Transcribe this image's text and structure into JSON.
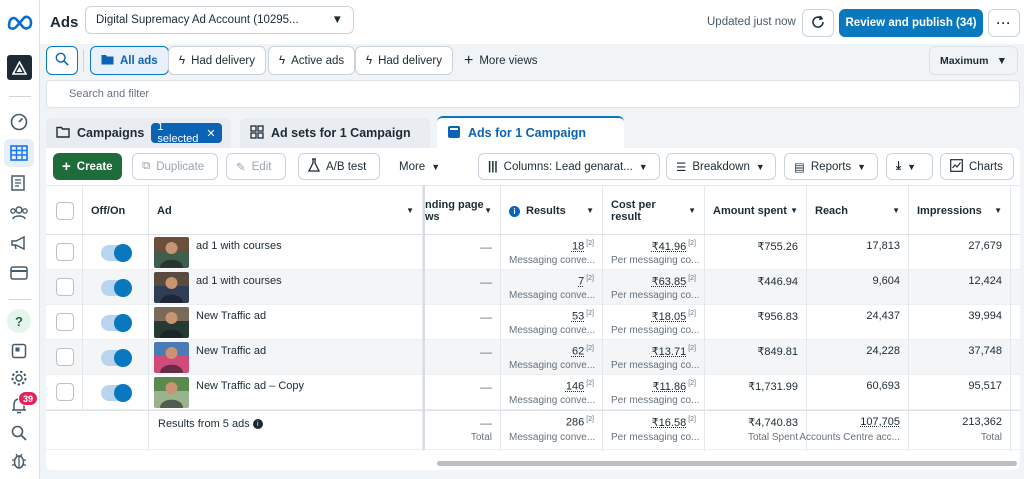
{
  "header": {
    "title": "Ads",
    "account": "Digital Supremacy Ad Account (10295...",
    "updated": "Updated just now",
    "publish_label": "Review and publish (34)"
  },
  "views": {
    "all_ads": "All ads",
    "had_delivery_1": "Had delivery",
    "active_ads": "Active ads",
    "had_delivery_2": "Had delivery",
    "more_views": "More views",
    "maximum": "Maximum"
  },
  "search": {
    "placeholder": "Search and filter"
  },
  "tabs": {
    "campaigns": "Campaigns",
    "selected_chip": "1 selected",
    "adsets": "Ad sets for 1 Campaign",
    "ads": "Ads for 1 Campaign"
  },
  "toolbar": {
    "create": "Create",
    "duplicate": "Duplicate",
    "edit": "Edit",
    "ab_test": "A/B test",
    "more": "More",
    "columns": "Columns: Lead genarat...",
    "breakdown": "Breakdown",
    "reports": "Reports",
    "charts": "Charts"
  },
  "columns": {
    "offon": "Off/On",
    "ad": "Ad",
    "landing_1": "nding page",
    "landing_2": "ws",
    "results": "Results",
    "cost_1": "Cost per",
    "cost_2": "result",
    "amount": "Amount spent",
    "reach": "Reach",
    "impressions": "Impressions"
  },
  "sup_mark": "[2]",
  "dash": "—",
  "rows": [
    {
      "name": "ad 1 with courses",
      "results": "18",
      "results_sub": "Messaging conve...",
      "cost": "₹41.96",
      "cost_sub": "Per messaging co...",
      "amount": "₹755.26",
      "reach": "17,813",
      "impressions": "27,679"
    },
    {
      "name": "ad 1 with courses",
      "results": "7",
      "results_sub": "Messaging conve...",
      "cost": "₹63.85",
      "cost_sub": "Per messaging co...",
      "amount": "₹446.94",
      "reach": "9,604",
      "impressions": "12,424"
    },
    {
      "name": "New Traffic ad",
      "results": "53",
      "results_sub": "Messaging conve...",
      "cost": "₹18.05",
      "cost_sub": "Per messaging co...",
      "amount": "₹956.83",
      "reach": "24,437",
      "impressions": "39,994"
    },
    {
      "name": "New Traffic ad",
      "results": "62",
      "results_sub": "Messaging conve...",
      "cost": "₹13.71",
      "cost_sub": "Per messaging co...",
      "amount": "₹849.81",
      "reach": "24,228",
      "impressions": "37,748"
    },
    {
      "name": "New Traffic ad – Copy",
      "results": "146",
      "results_sub": "Messaging conve...",
      "cost": "₹11.86",
      "cost_sub": "Per messaging co...",
      "amount": "₹1,731.99",
      "reach": "60,693",
      "impressions": "95,517"
    }
  ],
  "totals": {
    "label": "Results from 5 ads",
    "landing_sub": "Total",
    "results": "286",
    "results_sub": "Messaging conve...",
    "cost": "₹16.58",
    "cost_sub": "Per messaging co...",
    "amount": "₹4,740.83",
    "amount_sub": "Total Spent",
    "reach": "107,705",
    "reach_sub": "Accounts Centre acc...",
    "impressions": "213,362",
    "impressions_sub": "Total"
  },
  "notifications": {
    "count": "39"
  },
  "colors": {
    "primary": "#0a78be",
    "create": "#1e6c3a",
    "badge": "#e0245e"
  },
  "icons": [
    "meta-logo-icon",
    "search-icon",
    "folder-icon",
    "lightning-icon",
    "plus-icon",
    "dashboard-icon",
    "table-icon",
    "document-icon",
    "audience-icon",
    "megaphone-icon",
    "card-icon",
    "help-icon",
    "catalog-icon",
    "gear-icon",
    "bell-icon",
    "bug-icon"
  ]
}
